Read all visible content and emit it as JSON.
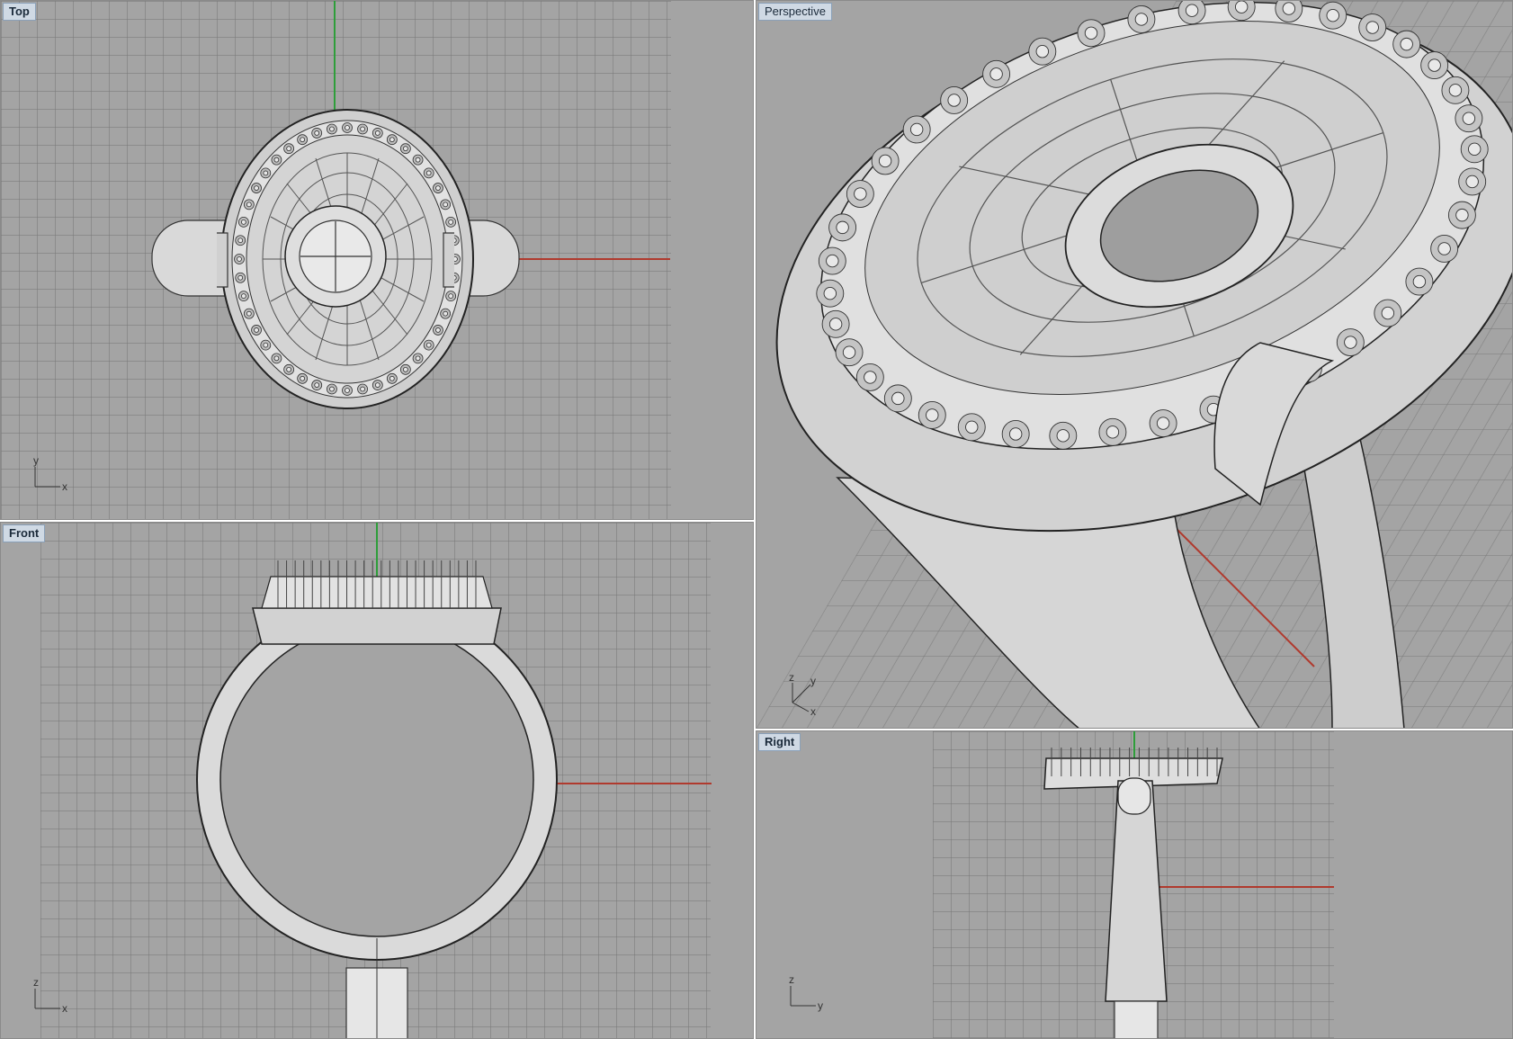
{
  "viewports": {
    "top": {
      "title": "Top",
      "axis_h": "x",
      "axis_v": "y"
    },
    "perspective": {
      "title": "Perspective",
      "axis_a": "z",
      "axis_b": "y",
      "axis_c": "x"
    },
    "front": {
      "title": "Front",
      "axis_h": "x",
      "axis_v": "z"
    },
    "right": {
      "title": "Right",
      "axis_h": "y",
      "axis_v": "z"
    }
  },
  "colors": {
    "background": "#a4a4a4",
    "grid": "#8c8c8c",
    "x_axis": "#b03a2e",
    "y_axis": "#2e9e3a",
    "metal": "#d8d8d8",
    "outline": "#222222"
  },
  "icons": {
    "axis_widget": "axis-triad-icon"
  }
}
